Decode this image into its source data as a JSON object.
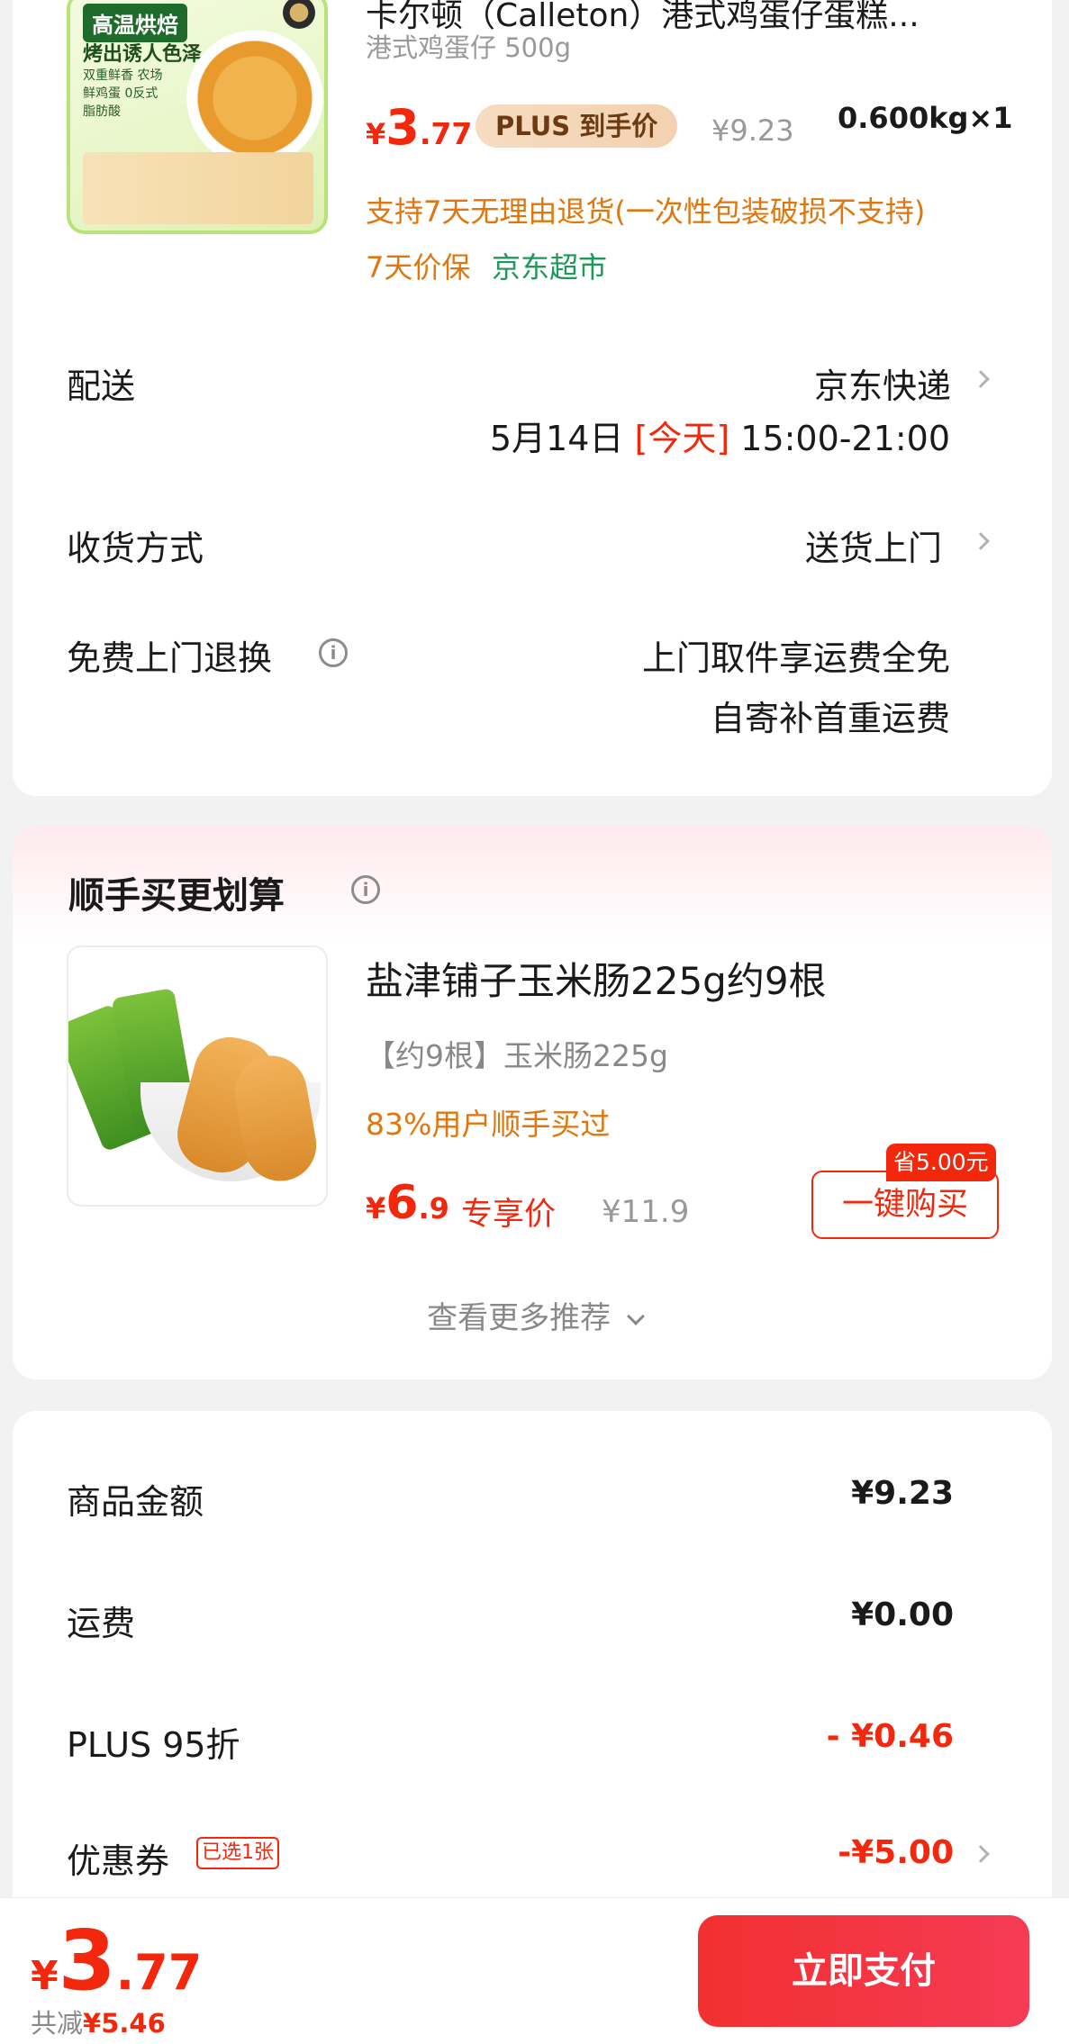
{
  "product": {
    "title": "卡尔顿（Calleton）港式鸡蛋仔蛋糕...",
    "spec": "港式鸡蛋仔 500g",
    "thumb_badge": "高温烘焙",
    "thumb_slogan": "烤出诱人色泽",
    "thumb_points": "双重鲜香 农场鲜鸡蛋 0反式脂肪酸",
    "price_yen": "¥",
    "price_int": "3",
    "price_dec": ".77",
    "plus_tag": "PLUS 到手价",
    "orig_price": "¥9.23",
    "qty": "0.600kg×1",
    "return_policy": "支持7天无理由退货(一次性包装破损不支持)",
    "price_protect": "7天价保",
    "store": "京东超市"
  },
  "delivery": {
    "label": "配送",
    "carrier": "京东快递",
    "date": "5月14日",
    "bracket_open": "[",
    "today": "今天",
    "bracket_close": "]",
    "time": "15:00-21:00"
  },
  "receive": {
    "label": "收货方式",
    "value": "送货上门"
  },
  "free_return": {
    "label": "免费上门退换",
    "line1": "上门取件享运费全免",
    "line2": "自寄补首重运费"
  },
  "recommend": {
    "title": "顺手买更划算",
    "item_title": "盐津铺子玉米肠225g约9根",
    "item_spec": "【约9根】玉米肠225g",
    "item_bought": "83%用户顺手买过",
    "price_yen": "¥",
    "price_int": "6",
    "price_dec": ".9",
    "price_tag": "专享价",
    "orig_price": "¥11.9",
    "save_badge": "省5.00元",
    "buy_button": "一键购买",
    "more": "查看更多推荐"
  },
  "summary": {
    "goods_label": "商品金额",
    "goods_value": "¥9.23",
    "shipping_label": "运费",
    "shipping_value": "¥0.00",
    "plus_label": "PLUS 95折",
    "plus_value": "- ¥0.46",
    "coupon_label": "优惠券",
    "coupon_tag": "已选1张",
    "coupon_value": "-¥5.00"
  },
  "bottom": {
    "price_yen": "¥",
    "price_int": "3",
    "price_dec": ".77",
    "save_label": "共减",
    "save_value": "¥5.46",
    "pay_button": "立即支付"
  },
  "colors": {
    "accent_red": "#f2270c",
    "promo_orange": "#e0760c",
    "store_green": "#1e9a58"
  }
}
